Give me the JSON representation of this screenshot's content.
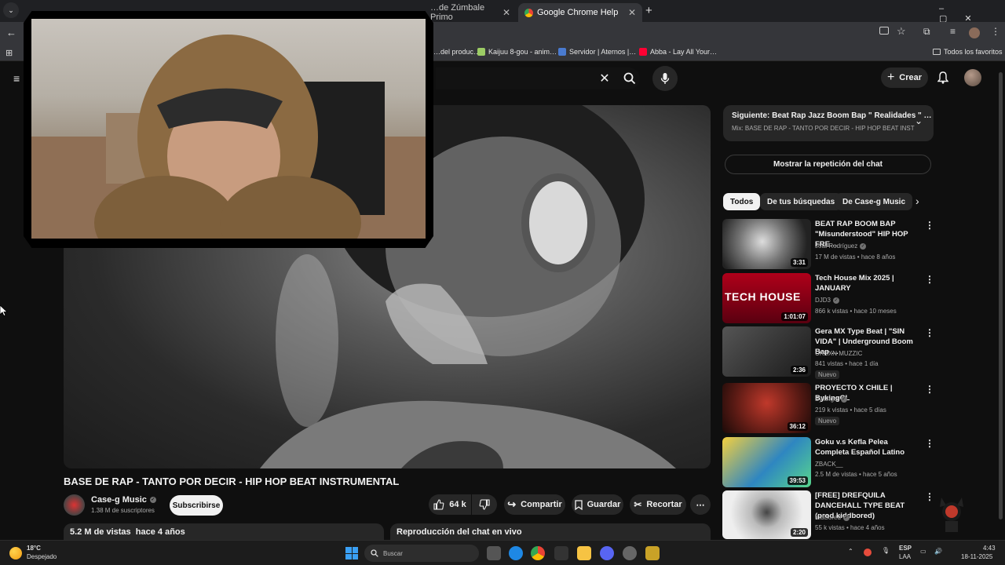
{
  "browser": {
    "tabs": [
      {
        "label": "…de Zúmbale Primo"
      },
      {
        "label": "Google Chrome Help"
      }
    ],
    "new_tab_symbol": "+",
    "bookmarks": [
      {
        "label": "…del produc…",
        "color": "#f3c136"
      },
      {
        "label": "Kaijuu 8-gou - anim…",
        "color": "#9ccc65"
      },
      {
        "label": "Servidor | Aternos |…",
        "color": "#4a7bd0"
      },
      {
        "label": "Abba - Lay All Your…",
        "color": "#ff0033"
      }
    ],
    "all_bookmarks": "Todos los favoritos"
  },
  "youtube": {
    "create_label": "Crear",
    "video_title": "BASE DE RAP - TANTO POR DECIR - HIP HOP BEAT INSTRUMENTAL",
    "channel": {
      "name": "Case-g Music",
      "subscribers": "1.38 M de suscriptores"
    },
    "subscribe_label": "Subscribirse",
    "likes": "64 k",
    "share_label": "Compartir",
    "save_label": "Guardar",
    "clip_label": "Recortar",
    "description": {
      "views": "5.2 M de vistas",
      "age": "hace 4 años"
    },
    "chat_replay_header": "Reproducción del chat en vivo",
    "next": {
      "label": "Siguiente:",
      "title": "Beat Rap Jazz Boom Bap \" Realidades \" …",
      "mix": "Mix: BASE DE RAP - TANTO POR DECIR - HIP HOP BEAT INST"
    },
    "show_chat_replay": "Mostrar la repetición del chat",
    "chips": [
      {
        "label": "Todos",
        "selected": true
      },
      {
        "label": "De tus búsquedas",
        "selected": false
      },
      {
        "label": "De Case-g Music",
        "selected": false
      }
    ],
    "recommendations": [
      {
        "title": "BEAT RAP BOOM BAP \"Misunderstood\" HIP HOP FRE…",
        "channel": "Jota Rodríguez",
        "verified": true,
        "meta": "17 M de vistas • hace 8 años",
        "duration": "3:31",
        "badge": ""
      },
      {
        "title": "Tech House Mix 2025 | JANUARY",
        "channel": "DJD3",
        "verified": true,
        "meta": "866 k vistas • hace 10 meses",
        "duration": "1:01:07",
        "badge": "",
        "thumb_text": "TECH HOUSE"
      },
      {
        "title": "Gera MX Type Beat | \"SIN VIDA\" | Underground Boom Bap …",
        "channel": "URBXN MUZZIC",
        "verified": false,
        "meta": "841 vistas • hace 1 día",
        "duration": "2:36",
        "badge": "Nuevo"
      },
      {
        "title": "PROYECTO X CHILE | BykingCL",
        "channel": "Bykingcl",
        "verified": true,
        "meta": "219 k vistas • hace 5 días",
        "duration": "36:12",
        "badge": "Nuevo"
      },
      {
        "title": "Goku v.s Kefla Pelea Completa Español Latino",
        "channel": "ZBACK__",
        "verified": false,
        "meta": "2.5 M de vistas • hace 5 años",
        "duration": "39:53",
        "badge": ""
      },
      {
        "title": "[FREE] DREFQUILA DANCEHALL TYPE BEAT (prod kiddbored)",
        "channel": "KidBored",
        "verified": true,
        "meta": "55 k vistas • hace 4 años",
        "duration": "2:20",
        "badge": ""
      }
    ]
  },
  "taskbar": {
    "weather_temp": "18°C",
    "weather_desc": "Despejado",
    "search_placeholder": "Buscar",
    "lang_top": "ESP",
    "lang_bottom": "LAA",
    "time": "4:43",
    "date": "18-11-2025"
  }
}
